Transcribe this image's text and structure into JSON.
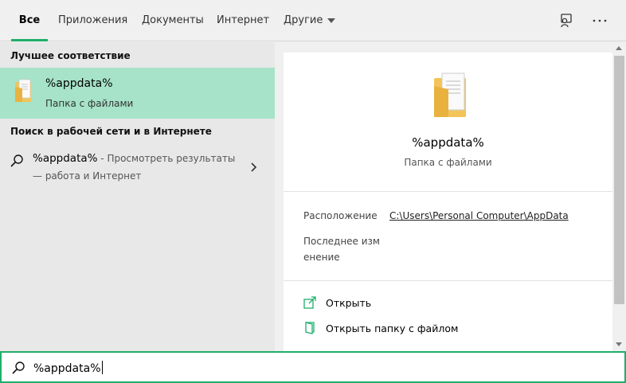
{
  "tabs": [
    {
      "label": "Все",
      "active": true
    },
    {
      "label": "Приложения"
    },
    {
      "label": "Документы"
    },
    {
      "label": "Интернет"
    },
    {
      "label": "Другие",
      "has_dropdown": true
    }
  ],
  "top_icons": [
    "feedback-icon",
    "more-options-icon"
  ],
  "left": {
    "best_match_heading": "Лучшее соответствие",
    "best_match": {
      "title": "%appdata%",
      "subtitle": "Папка с файлами",
      "icon": "folder-icon"
    },
    "web_heading": "Поиск в рабочей сети и в Интернете",
    "web_result": {
      "query": "%appdata%",
      "desc_line1": " - Просмотреть результаты",
      "desc_line2": "— работа и Интернет",
      "icon": "search-icon"
    }
  },
  "detail": {
    "title": "%appdata%",
    "subtitle": "Папка с файлами",
    "location_label": "Расположение",
    "location_value": "C:\\Users\\Personal Computer\\AppData",
    "modified_label": "Последнее изм енение",
    "actions": [
      {
        "label": "Открыть",
        "icon": "open-icon"
      },
      {
        "label": "Открыть папку с файлом",
        "icon": "open-folder-icon"
      }
    ]
  },
  "search": {
    "value": "%appdata%"
  },
  "colors": {
    "accent": "#1fae6a",
    "selection": "#a6e3c8",
    "folder": "#f2c45a"
  }
}
